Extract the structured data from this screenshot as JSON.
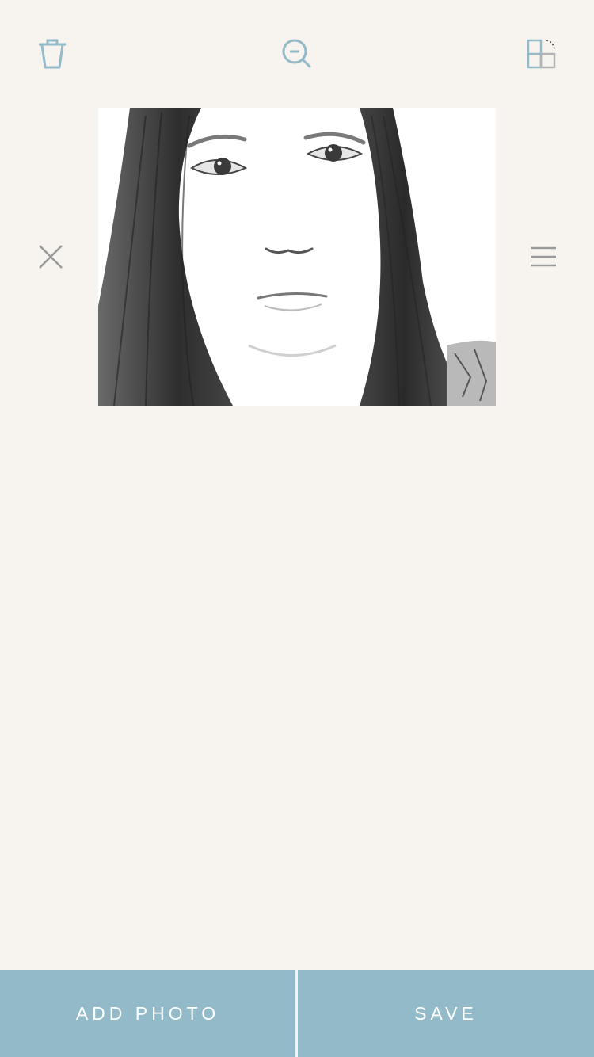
{
  "toolbar": {
    "icons": {
      "delete": "trash-icon",
      "zoom": "zoom-out-icon",
      "layout": "grid-layout-icon",
      "close": "close-icon",
      "menu": "menu-icon"
    }
  },
  "photo": {
    "description_icon": "portrait-photo"
  },
  "actions": {
    "add_photo_label": "ADD PHOTO",
    "save_label": "SAVE"
  },
  "colors": {
    "background": "#f7f4f0",
    "accent": "#93bac8",
    "icon_gray": "#9a9a9a",
    "button_text": "#ffffff"
  }
}
